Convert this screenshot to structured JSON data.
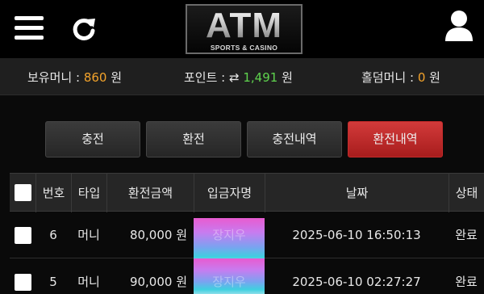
{
  "header": {
    "logo_main": "ATM",
    "logo_sub": "SPORTS & CASINO",
    "icons": {
      "menu": "hamburger-menu-icon",
      "refresh": "refresh-icon",
      "user": "user-icon"
    }
  },
  "balances": {
    "hold_label": "보유머니 :",
    "hold_value": "860",
    "hold_unit": "원",
    "point_label": "포인트 :",
    "point_icon": "⇄",
    "point_value": "1,491",
    "point_unit": "원",
    "holdem_label": "홀덤머니 :",
    "holdem_value": "0",
    "holdem_unit": "원"
  },
  "tabs": [
    {
      "label": "충전",
      "active": false
    },
    {
      "label": "환전",
      "active": false
    },
    {
      "label": "충전내역",
      "active": false
    },
    {
      "label": "환전내역",
      "active": true
    }
  ],
  "table": {
    "headers": [
      "번호",
      "타입",
      "환전금액",
      "입금자명",
      "날짜",
      "상태"
    ],
    "rows": [
      {
        "no": "6",
        "type": "머니",
        "amount": "80,000 원",
        "depositor": "장지우",
        "date": "2025-06-10 16:50:13",
        "status": "완료"
      },
      {
        "no": "5",
        "type": "머니",
        "amount": "90,000 원",
        "depositor": "장지우",
        "date": "2025-06-10 02:27:27",
        "status": "완료"
      }
    ]
  },
  "colors": {
    "accent_red": "#c42a2a",
    "orange": "#f3a32b",
    "green": "#5fd34e"
  }
}
